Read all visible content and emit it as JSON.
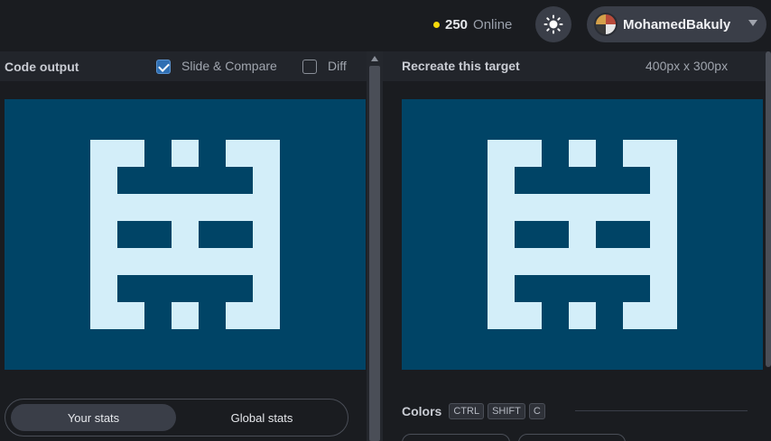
{
  "header": {
    "online_count": "250",
    "online_label": "Online",
    "username": "MohamedBakuly"
  },
  "left_panel": {
    "title": "Code output",
    "slide_compare_label": "Slide & Compare",
    "slide_compare_checked": true,
    "diff_label": "Diff",
    "diff_checked": false
  },
  "right_panel": {
    "title": "Recreate this target",
    "dimensions": "400px x 300px"
  },
  "stats_tabs": {
    "your_stats": "Your stats",
    "global_stats": "Global stats",
    "active": "your_stats"
  },
  "colors": {
    "title": "Colors",
    "shortcut_keys": [
      "CTRL",
      "SHIFT",
      "C"
    ],
    "background": "#004466",
    "foreground": "#d3eef9"
  },
  "icons": {
    "theme": "sun-icon",
    "dropdown": "chevron-down-icon"
  }
}
